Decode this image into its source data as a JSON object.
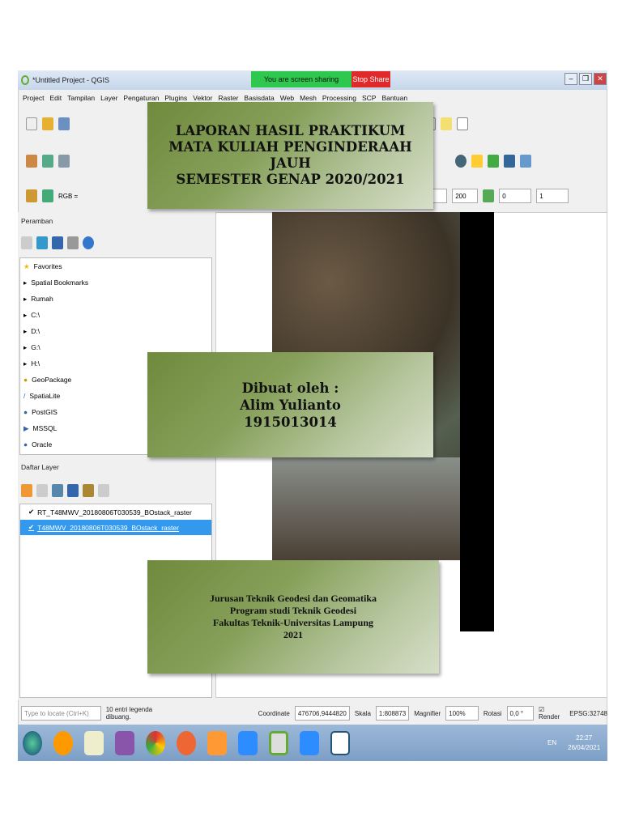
{
  "window": {
    "title": "*Untitled Project - QGIS",
    "sharing": "You are screen sharing",
    "stop_share": "Stop Share",
    "min": "–",
    "restore": "❐",
    "close": "✕"
  },
  "menu": [
    "Project",
    "Edit",
    "Tampilan",
    "Layer",
    "Pengaturan",
    "Plugins",
    "Vektor",
    "Raster",
    "Basisdata",
    "Web",
    "Mesh",
    "Processing",
    "SCP",
    "Bantuan"
  ],
  "toolbar": {
    "rgb": "RGB =",
    "v1": "0",
    "v2": "200",
    "v3": "0",
    "v4": "1"
  },
  "browser": {
    "title": "Peramban",
    "items": [
      "Favorites",
      "Spatial Bookmarks",
      "Rumah",
      "C:\\",
      "D:\\",
      "G:\\",
      "H:\\",
      "GeoPackage",
      "SpatiaLite",
      "PostGIS",
      "MSSQL",
      "Oracle"
    ]
  },
  "layers": {
    "title": "Daftar Layer",
    "items": [
      "RT_T48MWV_20180806T030539_BOstack_raster",
      "T48MWV_20180806T030539_BOstack_raster"
    ]
  },
  "status": {
    "locate_placeholder": "Type to locate (Ctrl+K)",
    "legend_msg": "10 entri legenda dibuang.",
    "coord_label": "Coordinate",
    "coord": "476706,9444820",
    "scale_label": "Skala",
    "scale": "1:808873",
    "magnifier_label": "Magnifier",
    "magnifier": "100%",
    "rotation_label": "Rotasi",
    "rotation": "0,0 °",
    "render": "Render",
    "crs": "EPSG:32748"
  },
  "tray": {
    "lang": "EN",
    "time": "22:27",
    "date": "26/04/2021"
  },
  "cover": {
    "title": [
      "LAPORAN HASIL PRAKTIKUM",
      "MATA KULIAH PENGINDERAAH",
      "JAUH",
      "SEMESTER GENAP 2020/2021"
    ],
    "author_label": "Dibuat oleh :",
    "author": "Alim Yulianto",
    "npm": "1915013014",
    "institution": [
      "Jurusan Teknik Geodesi dan Geomatika",
      "Program studi Teknik Geodesi",
      "Fakultas Teknik-Universitas Lampung",
      "2021"
    ]
  }
}
